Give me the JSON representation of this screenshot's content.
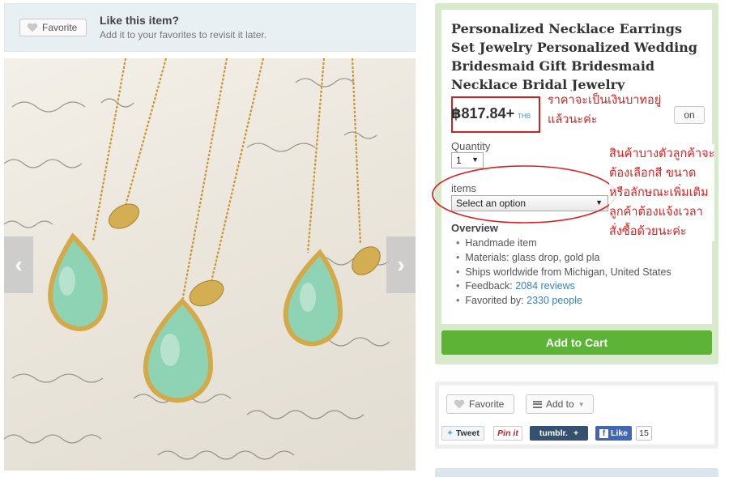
{
  "favorite_banner": {
    "button_label": "Favorite",
    "title": "Like this item?",
    "subtitle": "Add it to your favorites to revisit it later."
  },
  "gallery": {
    "prev_symbol": "‹",
    "next_symbol": "›"
  },
  "listing": {
    "title": "Personalized Necklace Earrings Set Jewelry Personalized Wedding Bridesmaid Gift Bridesmaid Necklace Bridal Jewelry Personalize Wedding",
    "price": "฿817.84+",
    "currency": "THB",
    "partial_button": "on",
    "quantity_label": "Quantity",
    "quantity_value": "1",
    "items_label": "items",
    "items_placeholder": "Select an option",
    "overview_title": "Overview",
    "overview": [
      {
        "text": "Handmade item"
      },
      {
        "text": "Materials: glass drop, gold pla"
      },
      {
        "text": "Ships worldwide from Michigan, United States"
      },
      {
        "text": "Feedback: ",
        "link": "2084 reviews"
      },
      {
        "text": "Favorited by: ",
        "link": "2330 people"
      }
    ],
    "add_to_cart": "Add to Cart"
  },
  "social": {
    "favorite_label": "Favorite",
    "add_to_label": "Add to",
    "tweet": "Tweet",
    "pinit": "Pin it",
    "tumblr": "tumblr.",
    "fb_like": "Like",
    "fb_count": "15"
  },
  "annotations": {
    "price_note": [
      "ราคาจะเป็นเงินบาทอยู่",
      "แล้วนะค่ะ"
    ],
    "option_note": [
      "สินค้าบางตัวลูกค้าจะ",
      "ต้องเลือกสี ขนาด",
      "หรือลักษณะเพิ่มเติม",
      "ลูกค้าต้องแจ้งเวลา",
      "สั่งซื้อด้วยนะค่ะ"
    ],
    "color": "#d62020"
  },
  "colors": {
    "accent_green": "#5cb335",
    "panel_green": "#d8e9cc",
    "link_blue": "#3b7fb9",
    "banner_blue": "#e9f0f3"
  }
}
